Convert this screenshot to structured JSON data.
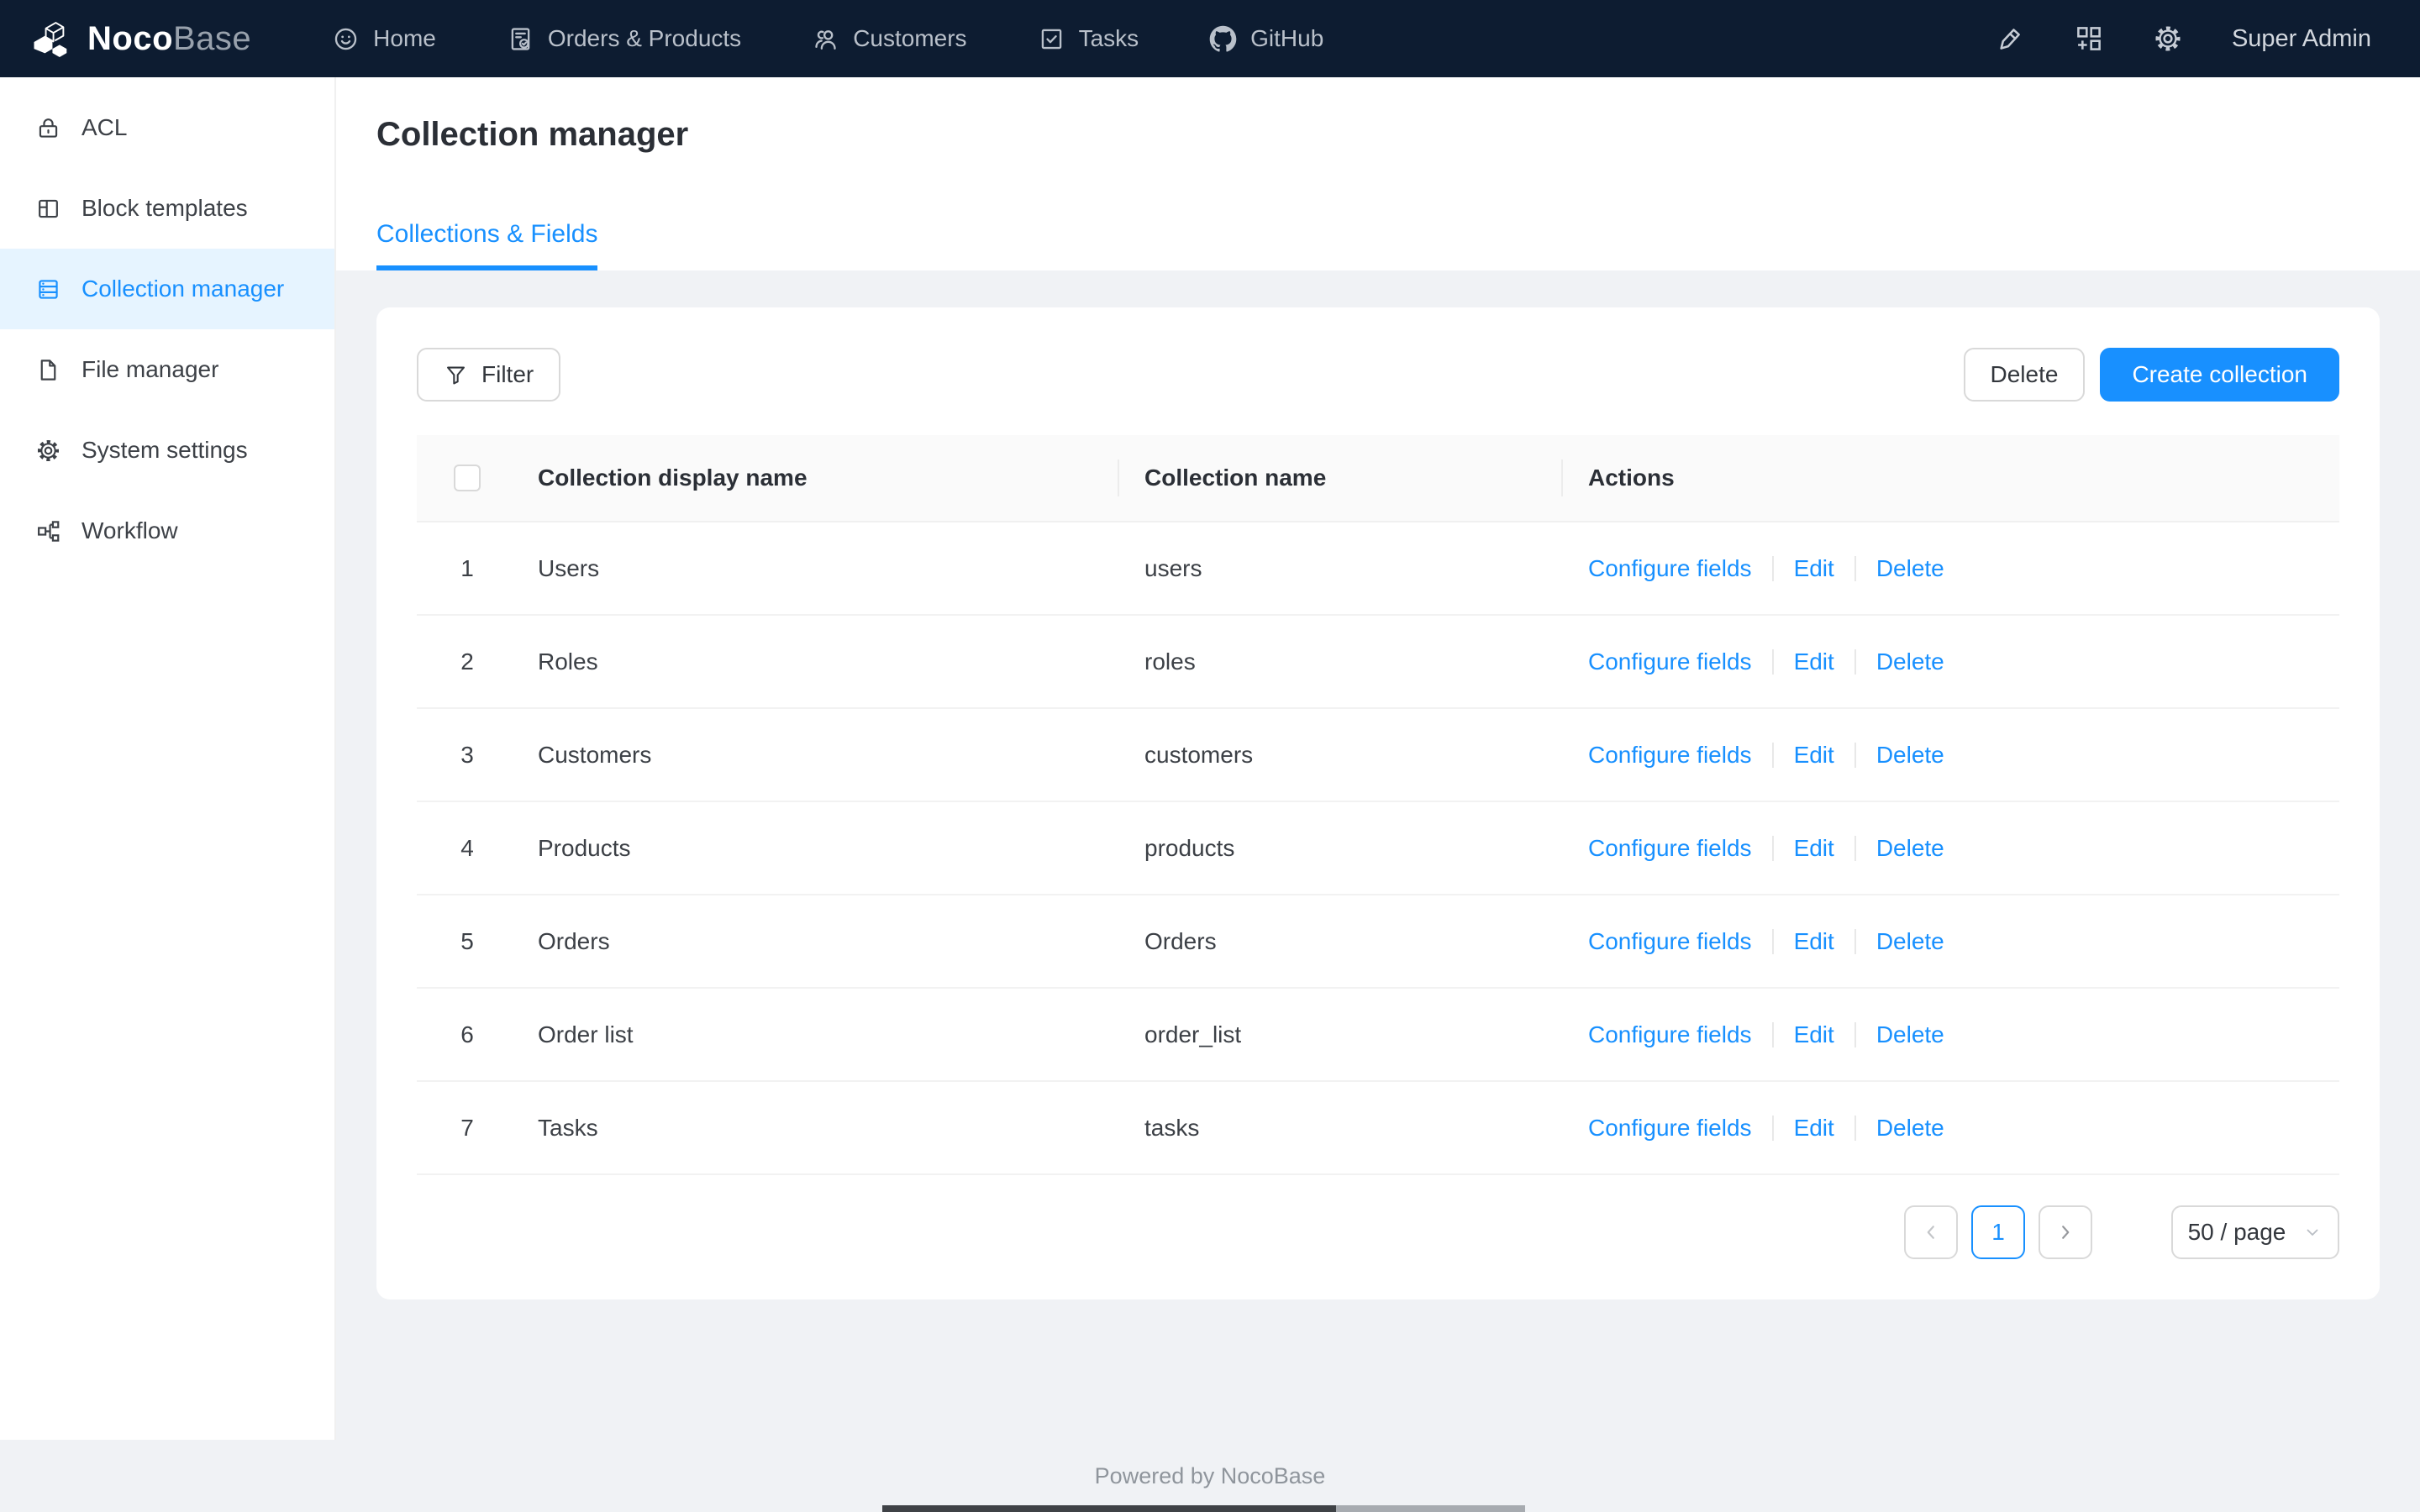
{
  "topbar": {
    "logo_primary": "Noco",
    "logo_secondary": "Base",
    "nav": [
      {
        "icon": "smile-icon",
        "label": "Home"
      },
      {
        "icon": "orders-icon",
        "label": "Orders & Products"
      },
      {
        "icon": "customers-icon",
        "label": "Customers"
      },
      {
        "icon": "tasks-icon",
        "label": "Tasks"
      },
      {
        "icon": "github-icon",
        "label": "GitHub"
      }
    ],
    "user": "Super Admin"
  },
  "sidebar": {
    "items": [
      {
        "icon": "lock-icon",
        "label": "ACL",
        "active": false
      },
      {
        "icon": "layout-icon",
        "label": "Block templates",
        "active": false
      },
      {
        "icon": "database-icon",
        "label": "Collection manager",
        "active": true
      },
      {
        "icon": "file-icon",
        "label": "File manager",
        "active": false
      },
      {
        "icon": "gear-icon",
        "label": "System settings",
        "active": false
      },
      {
        "icon": "workflow-icon",
        "label": "Workflow",
        "active": false
      }
    ]
  },
  "page": {
    "title": "Collection manager",
    "tab": "Collections & Fields"
  },
  "toolbar": {
    "filter_label": "Filter",
    "delete_label": "Delete",
    "create_label": "Create collection"
  },
  "table": {
    "headers": [
      "Collection display name",
      "Collection name",
      "Actions"
    ],
    "action_labels": [
      "Configure fields",
      "Edit",
      "Delete"
    ],
    "rows": [
      {
        "index": "1",
        "display_name": "Users",
        "collection_name": "users"
      },
      {
        "index": "2",
        "display_name": "Roles",
        "collection_name": "roles"
      },
      {
        "index": "3",
        "display_name": "Customers",
        "collection_name": "customers"
      },
      {
        "index": "4",
        "display_name": "Products",
        "collection_name": "products"
      },
      {
        "index": "5",
        "display_name": "Orders",
        "collection_name": "Orders"
      },
      {
        "index": "6",
        "display_name": "Order list",
        "collection_name": "order_list"
      },
      {
        "index": "7",
        "display_name": "Tasks",
        "collection_name": "tasks"
      }
    ]
  },
  "pagination": {
    "current_page": "1",
    "page_size": "50 / page"
  },
  "footer": {
    "text": "Powered by NocoBase"
  },
  "colors": {
    "accent": "#1890ff",
    "topbar_bg": "#0d1c31",
    "selected_item_bg": "#e6f4ff",
    "content_bg": "#f0f2f5"
  }
}
